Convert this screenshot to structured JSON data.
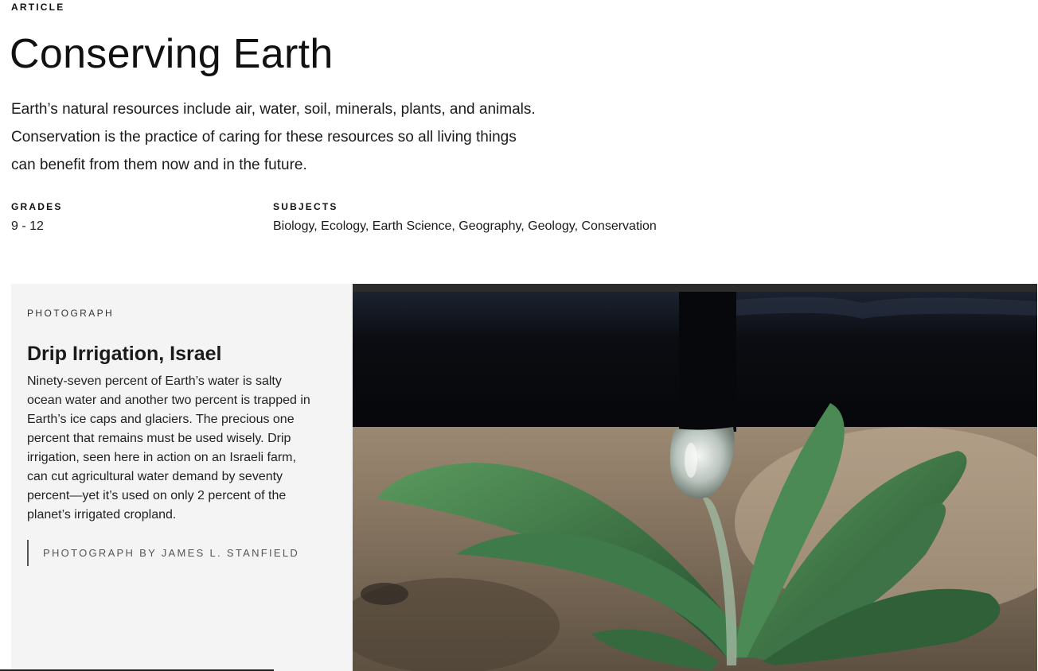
{
  "article": {
    "kicker": "ARTICLE",
    "title": "Conserving Earth",
    "lede_lines": [
      "Earth’s natural resources include air, water, soil, minerals, plants, and animals.",
      "Conservation is the practice of caring for these resources so all living things",
      "can benefit from them now and in the future."
    ],
    "grades_label": "GRADES",
    "grades_value": "9 - 12",
    "subjects_label": "SUBJECTS",
    "subjects_value": "Biology, Ecology, Earth Science, Geography, Geology, Conservation"
  },
  "photo": {
    "kicker": "PHOTOGRAPH",
    "title": "Drip Irrigation, Israel",
    "caption_lines": [
      "Ninety-seven percent of Earth’s water is salty",
      "ocean water and another two percent is trapped in",
      "Earth’s ice caps and glaciers. The precious one",
      "percent that remains must be used wisely. Drip",
      "irrigation, seen here in action on an Israeli farm,",
      "can cut agricultural water demand by seventy",
      "percent—yet it’s used on only 2 percent of the",
      "planet’s irrigated cropland."
    ],
    "credit": "PHOTOGRAPH BY JAMES L. STANFIELD",
    "image_alt": "Water drop falling from a drip irrigation pipe onto a young green plant"
  },
  "colors": {
    "panel_bg": "#f4f4f4",
    "pipe": "#0d0f14",
    "soil": "#8f7d68",
    "leaf": "#3f7a4a"
  }
}
